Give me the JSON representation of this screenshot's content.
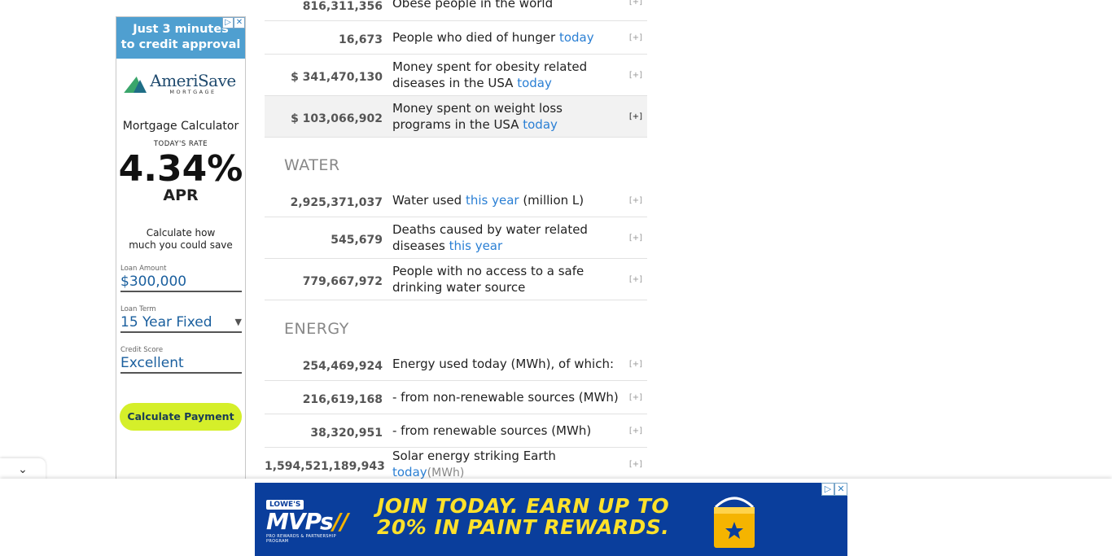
{
  "side_ad": {
    "headline_1": "Just 3 minutes",
    "headline_2": "to credit approval",
    "brand_name": "AmeriSave",
    "brand_sub": "MORTGAGE",
    "calc_title": "Mortgage Calculator",
    "rate_label": "TODAY'S RATE",
    "rate_value": "4.34%",
    "rate_unit": "APR",
    "note_1": "Calculate how",
    "note_2": "much you could save",
    "loan_amount_label": "Loan Amount",
    "loan_amount_value": "$300,000",
    "loan_term_label": "Loan Term",
    "loan_term_value": "15 Year Fixed",
    "credit_score_label": "Credit Score",
    "credit_score_value": "Excellent",
    "button_label": "Calculate Payment"
  },
  "rows_food": [
    {
      "value": "816,311,356",
      "label": "Obese people in the world",
      "highlight": "",
      "suffix": "",
      "plus": "[+]"
    },
    {
      "value": "16,673",
      "label": "People who died of hunger ",
      "highlight": "today",
      "suffix": "",
      "plus": "[+]"
    },
    {
      "value": "$ 341,470,130",
      "label": "Money spent for obesity related diseases in the USA ",
      "highlight": "today",
      "suffix": "",
      "plus": "[+]"
    },
    {
      "value": "$ 103,066,902",
      "label": "Money spent on weight loss programs in the USA ",
      "highlight": "today",
      "suffix": "",
      "plus": "[+]"
    }
  ],
  "section_water": "WATER",
  "rows_water": [
    {
      "value": "2,925,371,037",
      "label": "Water used ",
      "highlight": "this year",
      "suffix": " (million L)",
      "plus": "[+]"
    },
    {
      "value": "545,679",
      "label": "Deaths caused by water related diseases ",
      "highlight": "this year",
      "suffix": "",
      "plus": "[+]"
    },
    {
      "value": "779,667,972",
      "label": "People with no access to a safe drinking water source",
      "highlight": "",
      "suffix": "",
      "plus": "[+]"
    }
  ],
  "section_energy": "ENERGY",
  "rows_energy": [
    {
      "value": "254,469,924",
      "label": "Energy used today (MWh), of which:",
      "highlight": "",
      "suffix": "",
      "plus": "[+]"
    },
    {
      "value": "216,619,168",
      "label": "- from non-renewable sources (MWh)",
      "highlight": "",
      "suffix": "",
      "plus": "[+]"
    },
    {
      "value": "38,320,951",
      "label": "- from renewable sources (MWh)",
      "highlight": "",
      "suffix": "",
      "plus": "[+]"
    },
    {
      "value": "1,594,521,189,943",
      "label": "Solar energy striking Earth ",
      "highlight": "today",
      "suffix": "(MWh)",
      "plus": "[+]"
    }
  ],
  "bottom_ad": {
    "brand_badge": "LOWE'S",
    "brand_name": "MVPs",
    "brand_sub": "PRO REWARDS & PARTNERSHIP PROGRAM",
    "headline_1": "JOIN TODAY. EARN UP TO",
    "headline_2": "20% IN PAINT REWARDS."
  },
  "colors": {
    "highlight": "#2a7fd4",
    "ad_blue": "#0a3e9c",
    "ad_yellow": "#ffe12b",
    "button_lime": "#d5ef2a"
  }
}
